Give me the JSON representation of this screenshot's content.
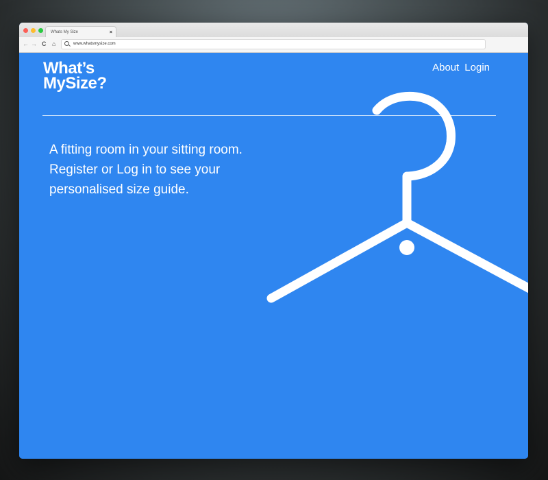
{
  "browser": {
    "tab_title": "Whats My Size",
    "tab_close": "×",
    "url": "www.whatsmysize.com"
  },
  "site": {
    "logo_line1": "What’s",
    "logo_line2": "MySize?",
    "nav": {
      "about": "About",
      "login": "Login"
    },
    "hero_line1": "A fitting room in your sitting room.",
    "hero_line2": "Register or Log in to see your",
    "hero_line3": "personalised size guide.",
    "colors": {
      "background": "#2f86f0",
      "text": "#ffffff"
    },
    "illustration": "coat-hanger-icon"
  }
}
